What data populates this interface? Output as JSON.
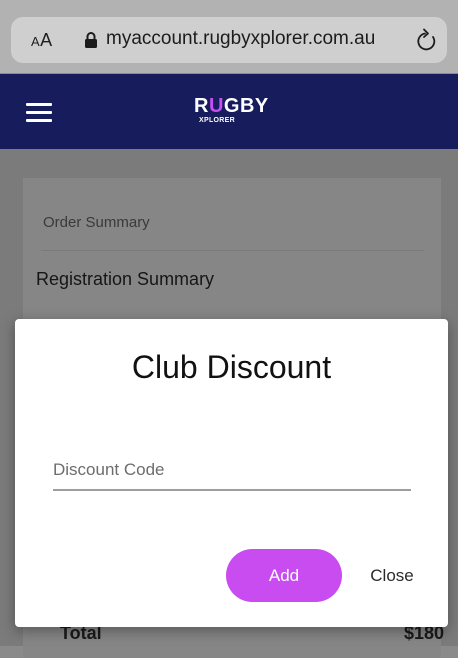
{
  "browser": {
    "text_size_label_small": "A",
    "text_size_label_large": "A",
    "url": "myaccount.rugbyxplorer.com.au",
    "lock_icon": "lock-icon",
    "reload_icon": "reload-icon"
  },
  "header": {
    "menu_icon": "hamburger-icon",
    "logo": {
      "main_prefix": "R",
      "main_accent": "U",
      "main_suffix": "GBY",
      "sub": "XPLORER"
    },
    "colors": {
      "background": "#171c5d",
      "accent": "#c54ff0"
    }
  },
  "page": {
    "order_summary_label": "Order Summary",
    "registration_summary_label": "Registration Summary",
    "total_label": "Total",
    "total_value": "$180"
  },
  "modal": {
    "title": "Club Discount",
    "discount_field": {
      "placeholder": "Discount Code",
      "value": ""
    },
    "add_label": "Add",
    "close_label": "Close",
    "colors": {
      "add_button": "#c84cf0"
    }
  }
}
